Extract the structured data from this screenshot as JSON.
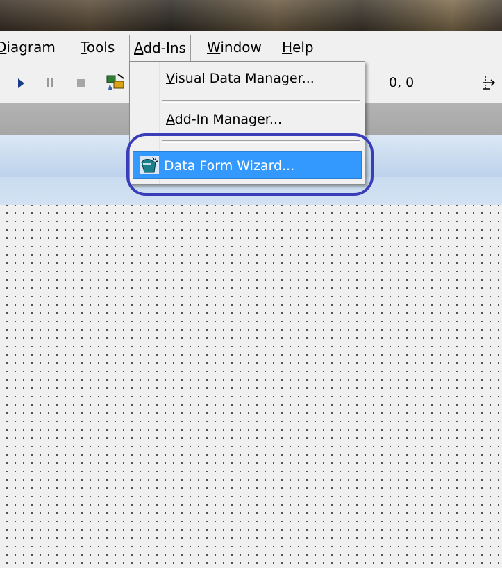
{
  "menubar": {
    "items": [
      {
        "label_first": "D",
        "label_rest": "iagram"
      },
      {
        "label_first": "T",
        "label_rest": "ools"
      },
      {
        "label_first": "A",
        "label_rest": "dd-Ins"
      },
      {
        "label_first": "W",
        "label_rest": "indow"
      },
      {
        "label_first": "H",
        "label_rest": "elp"
      }
    ]
  },
  "toolbar": {
    "coords": "0, 0",
    "icons": [
      "run-icon",
      "pause-icon",
      "stop-icon",
      "data-view-icon",
      "size-icon"
    ]
  },
  "addins_menu": {
    "items": [
      {
        "label_first": "V",
        "label_rest": "isual Data Manager..."
      },
      {
        "label_first": "A",
        "label_rest": "dd-In Manager..."
      },
      {
        "label": "Data Form Wizard...",
        "highlighted": true
      }
    ]
  },
  "colors": {
    "highlight": "#3399ff",
    "annotation": "#3a3db8"
  }
}
